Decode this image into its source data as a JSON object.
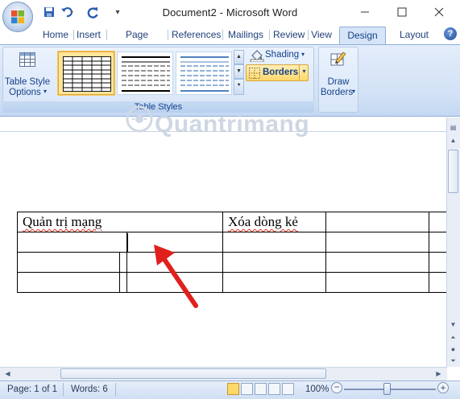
{
  "window": {
    "title": "Document2 - Microsoft Word",
    "minimize_icon": "minimize-icon",
    "maximize_icon": "maximize-icon",
    "close_icon": "close-icon"
  },
  "quick_access": [
    "save-icon",
    "undo-icon",
    "redo-icon",
    "customize-icon"
  ],
  "tabs": [
    {
      "label": "Home"
    },
    {
      "label": "Insert"
    },
    {
      "label": "Page Layout"
    },
    {
      "label": "References"
    },
    {
      "label": "Mailings"
    },
    {
      "label": "Review"
    },
    {
      "label": "View"
    },
    {
      "label": "Design",
      "active": true
    },
    {
      "label": "Layout"
    }
  ],
  "ribbon": {
    "table_style_options": "Table Style\nOptions",
    "table_style_options_line1": "Table Style",
    "table_style_options_line2": "Options",
    "table_styles_group": "Table Styles",
    "shading": "Shading",
    "borders": "Borders",
    "draw_borders_line1": "Draw",
    "draw_borders_line2": "Borders"
  },
  "watermark": "Quantrimang",
  "document": {
    "table": [
      [
        "Quản trị mạng",
        "",
        "Xóa dòng kẻ",
        ""
      ],
      [
        "",
        "",
        "",
        ""
      ],
      [
        "",
        "",
        "",
        ""
      ],
      [
        "",
        "",
        "",
        ""
      ]
    ]
  },
  "status": {
    "page": "Page: 1 of 1",
    "words": "Words: 6",
    "zoom": "100%",
    "zoom_percent": 100
  },
  "colors": {
    "ribbon_text": "#15428b",
    "active_tab_bg": "#d6e4f7",
    "arrow": "#e0201c",
    "spell_underline": "#e0321d"
  }
}
